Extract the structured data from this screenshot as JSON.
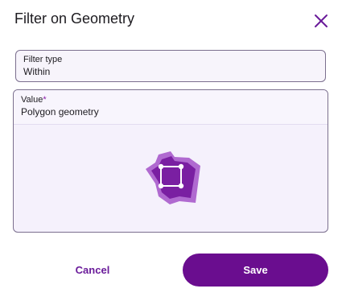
{
  "dialog": {
    "title": "Filter on Geometry",
    "close_icon": "close-icon"
  },
  "filter_type": {
    "label": "Filter type",
    "value": "Within"
  },
  "value_field": {
    "label": "Value",
    "required_marker": "*",
    "value": "Polygon geometry",
    "preview_icon": "polygon-geometry-icon"
  },
  "actions": {
    "cancel_label": "Cancel",
    "save_label": "Save"
  },
  "colors": {
    "accent": "#6a0d8f",
    "polygon_outer": "#b06ad0",
    "polygon_inner": "#7a1fa2",
    "border": "#7b6f8e",
    "background_tint": "#f5f1fc"
  }
}
